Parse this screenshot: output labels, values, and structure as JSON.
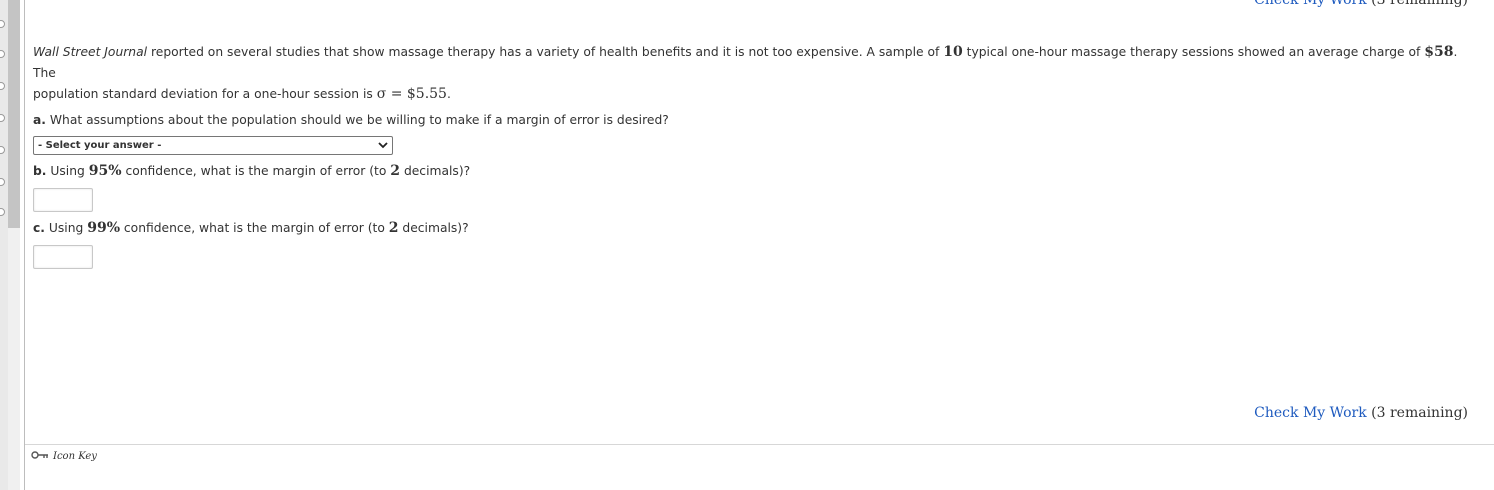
{
  "check_work": {
    "link": "Check My Work",
    "remaining": "(3 remaining)"
  },
  "problem": {
    "source": "Wall Street Journal",
    "text1": " reported on several studies that show massage therapy has a variety of health benefits and it is not too expensive. A sample of ",
    "n": "10",
    "text2": " typical one-hour massage therapy sessions showed an average charge of ",
    "mean": "$58",
    "text3": ". The",
    "text4": "population standard deviation for a one-hour session is ",
    "sigma_eq": "σ = $5.55",
    "text5": "."
  },
  "q_a": {
    "label": "a.",
    "text": " What assumptions about the population should we be willing to make if a margin of error is desired?",
    "select_value": "- Select your answer -"
  },
  "q_b": {
    "label": "b.",
    "text1": " Using ",
    "conf": "95%",
    "text2": " confidence, what is the margin of error (to ",
    "dec": "2",
    "text3": " decimals)?",
    "value": ""
  },
  "q_c": {
    "label": "c.",
    "text1": " Using ",
    "conf": "99%",
    "text2": " confidence, what is the margin of error (to ",
    "dec": "2",
    "text3": " decimals)?",
    "value": ""
  },
  "icon_key": {
    "label": "Icon Key"
  }
}
